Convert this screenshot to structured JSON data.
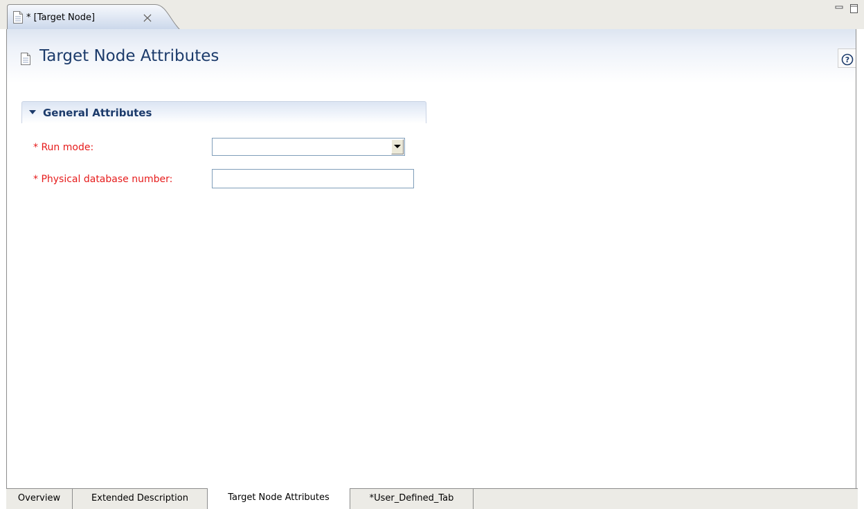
{
  "editor_tab": {
    "title": "* [Target Node]",
    "icon": "document-icon",
    "close_icon": "close-icon"
  },
  "window_controls": {
    "minimize_icon": "minimize-icon",
    "maximize_icon": "maximize-icon"
  },
  "form": {
    "title": "Target Node Attributes",
    "icon": "document-icon",
    "help_icon": "help-icon"
  },
  "section": {
    "title": "General Attributes",
    "expanded": true,
    "fields": [
      {
        "label": "* Run mode:",
        "type": "combo",
        "value": ""
      },
      {
        "label": "* Physical database number:",
        "type": "text",
        "value": ""
      }
    ]
  },
  "page_tabs": [
    {
      "label": "Overview",
      "active": false
    },
    {
      "label": "Extended Description",
      "active": false
    },
    {
      "label": "Target Node Attributes",
      "active": true
    },
    {
      "label": "*User_Defined_Tab",
      "active": false
    }
  ],
  "colors": {
    "title_blue": "#1c3b6b",
    "required_red": "#e61b1b",
    "chrome_gray": "#ecebe6"
  }
}
